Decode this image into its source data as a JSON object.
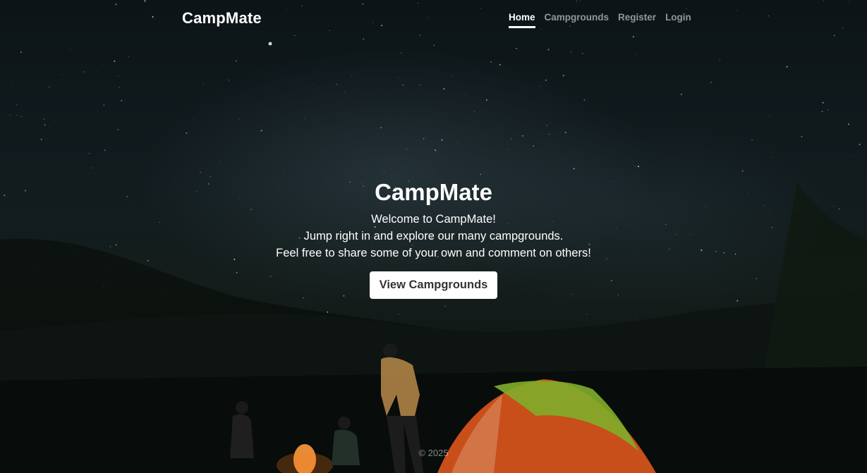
{
  "navbar": {
    "brand": "CampMate",
    "links": [
      {
        "label": "Home",
        "active": true
      },
      {
        "label": "Campgrounds",
        "active": false
      },
      {
        "label": "Register",
        "active": false
      },
      {
        "label": "Login",
        "active": false
      }
    ]
  },
  "hero": {
    "title": "CampMate",
    "lines": [
      "Welcome to CampMate!",
      "Jump right in and explore our many campgrounds.",
      "Feel free to share some of your own and comment on others!"
    ],
    "button_label": "View Campgrounds"
  },
  "footer": {
    "text": "© 2025"
  },
  "colors": {
    "background": "#121c1f",
    "tent_orange": "#d9551c",
    "tent_green": "#7fae2a",
    "fire": "#ff9a3c"
  }
}
